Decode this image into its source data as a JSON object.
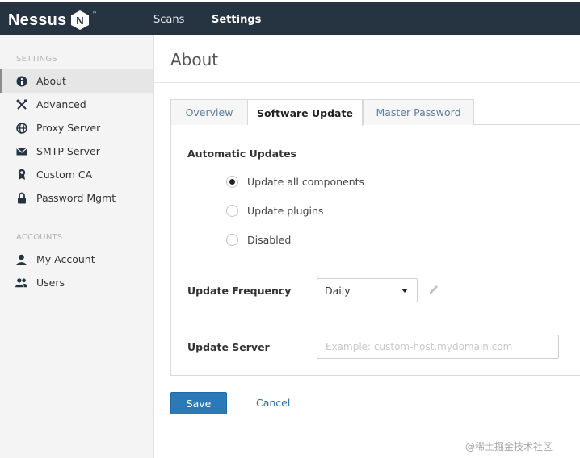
{
  "app": {
    "logo_text": "Nessus",
    "logo_badge": "N",
    "logo_tm": "™"
  },
  "topnav": {
    "scans": "Scans",
    "settings": "Settings"
  },
  "sidebar": {
    "settings_heading": "SETTINGS",
    "settings_items": [
      {
        "label": "About",
        "icon": "info-icon",
        "active": true
      },
      {
        "label": "Advanced",
        "icon": "tools-icon"
      },
      {
        "label": "Proxy Server",
        "icon": "globe-icon"
      },
      {
        "label": "SMTP Server",
        "icon": "envelope-icon"
      },
      {
        "label": "Custom CA",
        "icon": "certificate-icon"
      },
      {
        "label": "Password Mgmt",
        "icon": "lock-icon"
      }
    ],
    "accounts_heading": "ACCOUNTS",
    "accounts_items": [
      {
        "label": "My Account",
        "icon": "user-icon"
      },
      {
        "label": "Users",
        "icon": "users-icon"
      }
    ]
  },
  "main": {
    "title": "About",
    "tabs": [
      {
        "label": "Overview"
      },
      {
        "label": "Software Update",
        "active": true
      },
      {
        "label": "Master Password"
      }
    ],
    "automatic_updates": {
      "label": "Automatic Updates",
      "options": [
        {
          "label": "Update all components",
          "selected": true
        },
        {
          "label": "Update plugins",
          "selected": false
        },
        {
          "label": "Disabled",
          "selected": false
        }
      ]
    },
    "update_frequency": {
      "label": "Update Frequency",
      "value": "Daily"
    },
    "update_server": {
      "label": "Update Server",
      "value": "",
      "placeholder": "Example: custom-host.mydomain.com"
    },
    "save_label": "Save",
    "cancel_label": "Cancel"
  },
  "watermark": "@稀土掘金技术社区",
  "colors": {
    "topbar": "#263341",
    "accent": "#2a7ab8",
    "link": "#2a6fa6"
  }
}
